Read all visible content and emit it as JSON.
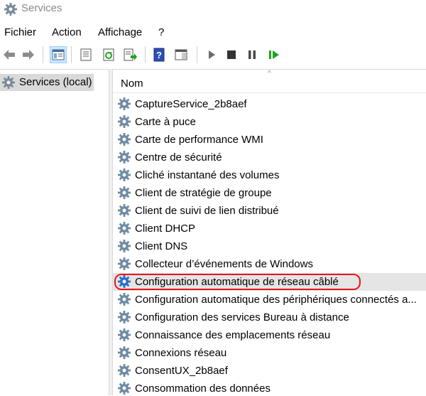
{
  "window": {
    "title": "Services",
    "icon": "services-gear-icon"
  },
  "menu": [
    "Fichier",
    "Action",
    "Affichage",
    "?"
  ],
  "toolbar": {
    "buttons": [
      "back-arrow-icon",
      "forward-arrow-icon",
      "console-tree-icon",
      "properties-icon",
      "refresh-icon",
      "export-list-icon",
      "help-icon",
      "action-pane-icon",
      "start-service-icon",
      "stop-service-icon",
      "pause-service-icon",
      "resume-service-icon"
    ]
  },
  "tree": {
    "selected_label": "Services (local)",
    "icon": "services-gear-icon"
  },
  "list": {
    "column_header": "Nom",
    "sort_indicator": "^",
    "selected_index": 9,
    "rows": [
      "CaptureService_2b8aef",
      "Carte à puce",
      "Carte de performance WMI",
      "Centre de sécurité",
      "Cliché instantané des volumes",
      "Client de stratégie de groupe",
      "Client de suivi de lien distribué",
      "Client DHCP",
      "Client DNS",
      "Collecteur d’événements de Windows",
      "Configuration automatique de réseau câblé",
      "Configuration automatique des périphériques connectés a...",
      "Configuration des services Bureau à distance",
      "Connaissance des emplacements réseau",
      "Connexions réseau",
      "ConsentUX_2b8aef",
      "Consommation des données"
    ]
  },
  "annotation": {
    "highlighted_row_index": 10,
    "color": "#e8151b"
  },
  "colors": {
    "selection": "#e5e5e5",
    "tree_selection": "#d9d9d9",
    "play_green": "#1fa31f"
  }
}
